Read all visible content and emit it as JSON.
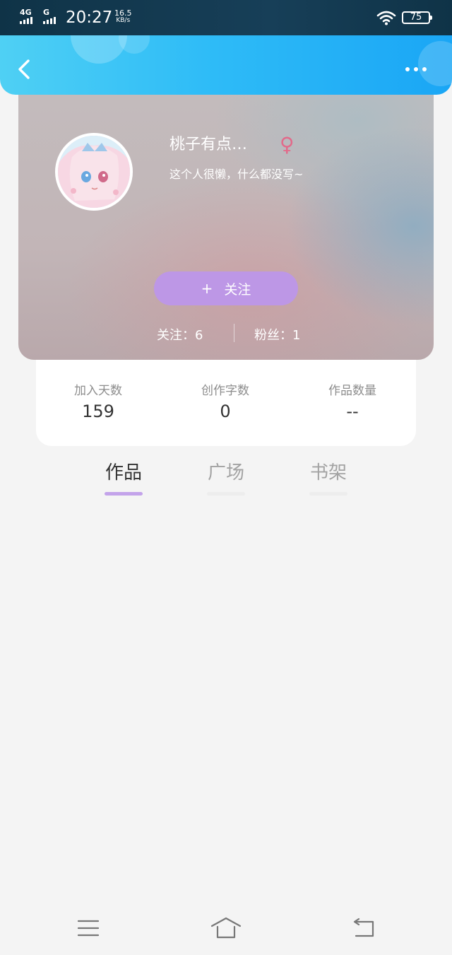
{
  "status_bar": {
    "network_1": "4G",
    "network_2": "G",
    "time": "20:27",
    "speed_value": "16.5",
    "speed_unit": "KB/s",
    "battery": "75"
  },
  "header": {
    "back_icon": "chevron-left-icon",
    "more_icon": "more-dots-icon"
  },
  "profile": {
    "nickname": "桃子有点…",
    "gender_symbol": "♀",
    "bio": "这个人很懒，什么都没写~",
    "follow_plus": "+",
    "follow_label": "关注",
    "following": "关注：6",
    "fans": "粉丝：1"
  },
  "stats": [
    {
      "label": "加入天数",
      "value": "159"
    },
    {
      "label": "创作字数",
      "value": "0"
    },
    {
      "label": "作品数量",
      "value": "--"
    }
  ],
  "tabs": [
    {
      "label": "作品",
      "active": true
    },
    {
      "label": "广场",
      "active": false
    },
    {
      "label": "书架",
      "active": false
    }
  ],
  "nav": {
    "menu_icon": "menu-icon",
    "home_icon": "home-icon",
    "back_icon": "back-arrow-icon"
  },
  "colors": {
    "header_accent": "#2fbcf7",
    "follow_button": "#bd97e6",
    "gender_icon": "#e26a8a",
    "tab_indicator": "#c3a3ea"
  }
}
